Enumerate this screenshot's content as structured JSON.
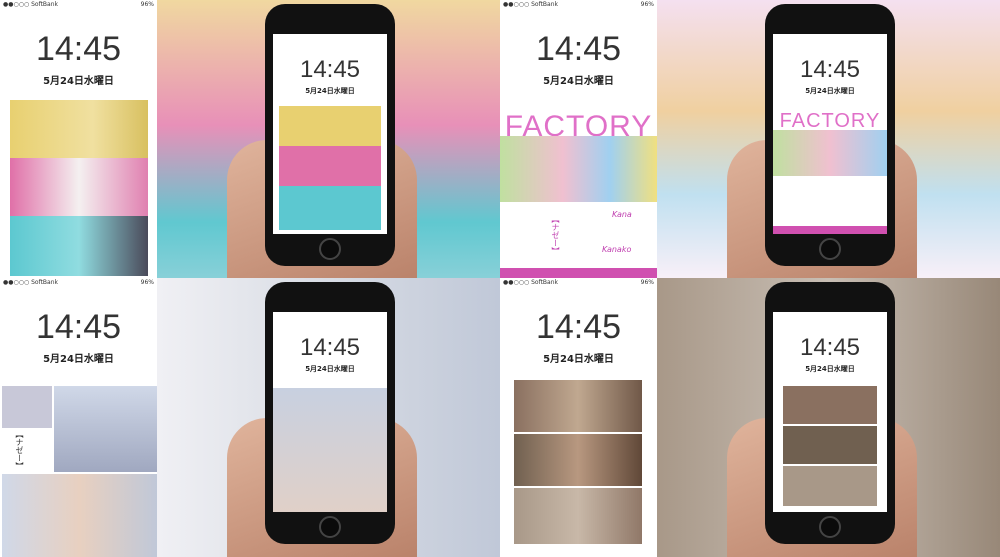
{
  "status": {
    "carrier": "●●○○○ SoftBank",
    "battery": "96%"
  },
  "clock": {
    "time": "14:45",
    "date": "5月24日水曜日"
  },
  "factory": {
    "title": "FACTORY",
    "song": "【ナゼー】",
    "sig1": "Kanako",
    "sig2": "Kana"
  },
  "colors": {
    "yellow": "#e8d070",
    "pink": "#e070a8",
    "cyan": "#5cc8d0",
    "magenta": "#d050b0"
  }
}
